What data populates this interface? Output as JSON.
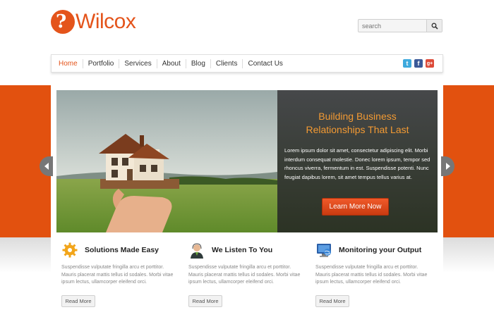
{
  "brand": {
    "logo_glyph": "?",
    "name": "Wilcox",
    "color": "#e4541b"
  },
  "search": {
    "placeholder": "search",
    "icon": "magnifier-icon"
  },
  "nav": {
    "items": [
      "Home",
      "Portfolio",
      "Services",
      "About",
      "Blog",
      "Clients",
      "Contact Us"
    ],
    "active": "Home",
    "socials": [
      {
        "icon": "twitter-icon",
        "glyph": "t",
        "color": "#3ea9dd"
      },
      {
        "icon": "facebook-icon",
        "glyph": "f",
        "color": "#3b5998"
      },
      {
        "icon": "google-plus-icon",
        "glyph": "g+",
        "color": "#dd4b39"
      }
    ]
  },
  "hero": {
    "title_line1": "Building Business",
    "title_line2": "Relationships That Last",
    "text": "Lorem ipsum dolor sit amet, consectetur adipiscing elit. Morbi interdum consequat molestie. Donec lorem ipsum, tempor sed rhoncus viverra, fermentum in est. Suspendisse potenti. Nunc feugiat dapibus lorem, sit amet tempus tellus varius at.",
    "button": "Learn More Now",
    "band_color": "#e2510f"
  },
  "features": [
    {
      "icon": "gear-icon",
      "title": "Solutions Made Easy",
      "text": "Suspendisse vulputate fringilla arcu et porttitor. Mauris placerat mattis tellus id sodales. Morbi vitae ipsum lectus, ullamcorper eleifend orci.",
      "button": "Read More"
    },
    {
      "icon": "user-headset-icon",
      "title": "We Listen To You",
      "text": "Suspendisse vulputate fringilla arcu et porttitor. Mauris placerat mattis tellus id sodales. Morbi vitae ipsum lectus, ullamcorper eleifend orci.",
      "button": "Read More"
    },
    {
      "icon": "monitor-globe-icon",
      "title": "Monitoring your Output",
      "text": "Suspendisse vulputate fringilla arcu et porttitor. Mauris placerat mattis tellus id sodales. Morbi vitae ipsum lectus, ullamcorper eleifend orci.",
      "button": "Read More"
    }
  ]
}
